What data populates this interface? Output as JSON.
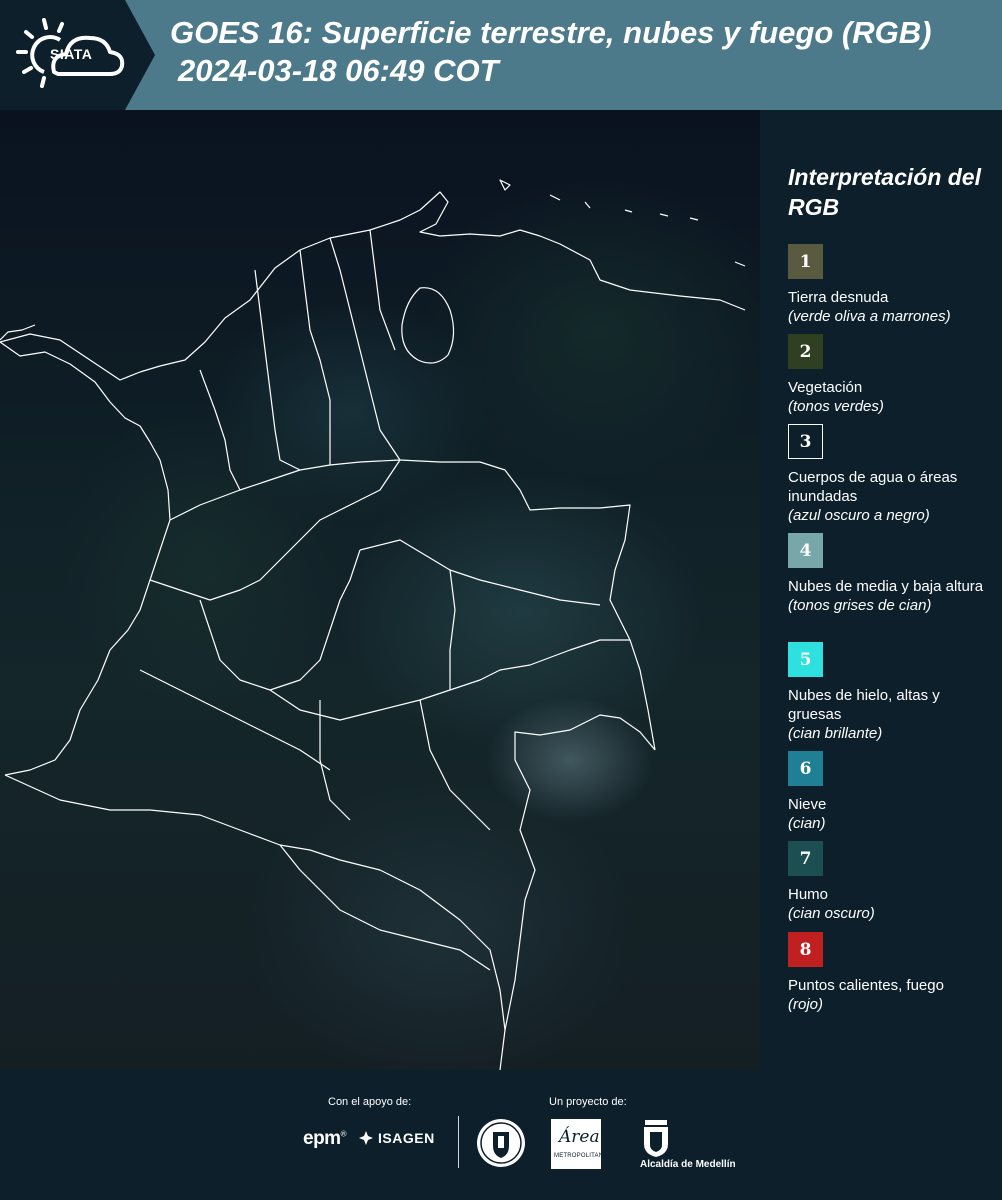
{
  "header": {
    "logo_text": "SIATA",
    "title_line1": "GOES 16: Superficie terrestre, nubes y fuego (RGB)",
    "title_line2": "2024-03-18 06:49 COT",
    "background_color": "#4d7a8a"
  },
  "legend": {
    "title": "Interpretación del RGB",
    "items": [
      {
        "number": "1",
        "label": "Tierra desnuda",
        "sublabel": "(verde oliva a marrones)",
        "color": "#5a5a40"
      },
      {
        "number": "2",
        "label": "Vegetación",
        "sublabel": "(tonos verdes)",
        "color": "#2e3f22"
      },
      {
        "number": "3",
        "label": "Cuerpos de agua o áreas inundadas",
        "sublabel": "(azul oscuro a negro)",
        "color": "#0c1f2b"
      },
      {
        "number": "4",
        "label": "Nubes de media y baja altura",
        "sublabel": "(tonos grises de cian)",
        "color": "#78a7aa"
      },
      {
        "number": "5",
        "label": "Nubes de hielo, altas y gruesas",
        "sublabel": "(cian brillante)",
        "color": "#2ee0e0"
      },
      {
        "number": "6",
        "label": "Nieve",
        "sublabel": "(cian)",
        "color": "#1f7f94"
      },
      {
        "number": "7",
        "label": "Humo",
        "sublabel": "(cian oscuro)",
        "color": "#1c4f52"
      },
      {
        "number": "8",
        "label": "Puntos calientes, fuego",
        "sublabel": "(rojo)",
        "color": "#c0201f"
      }
    ]
  },
  "footer": {
    "support_label": "Con el apoyo de:",
    "project_label": "Un proyecto de:",
    "sponsor_epm": "epm",
    "sponsor_isagen": "ISAGEN",
    "area_logo_text": "Área",
    "area_logo_subtext": "METROPOLITANA",
    "medellin_text": "Alcaldía de Medellín"
  }
}
